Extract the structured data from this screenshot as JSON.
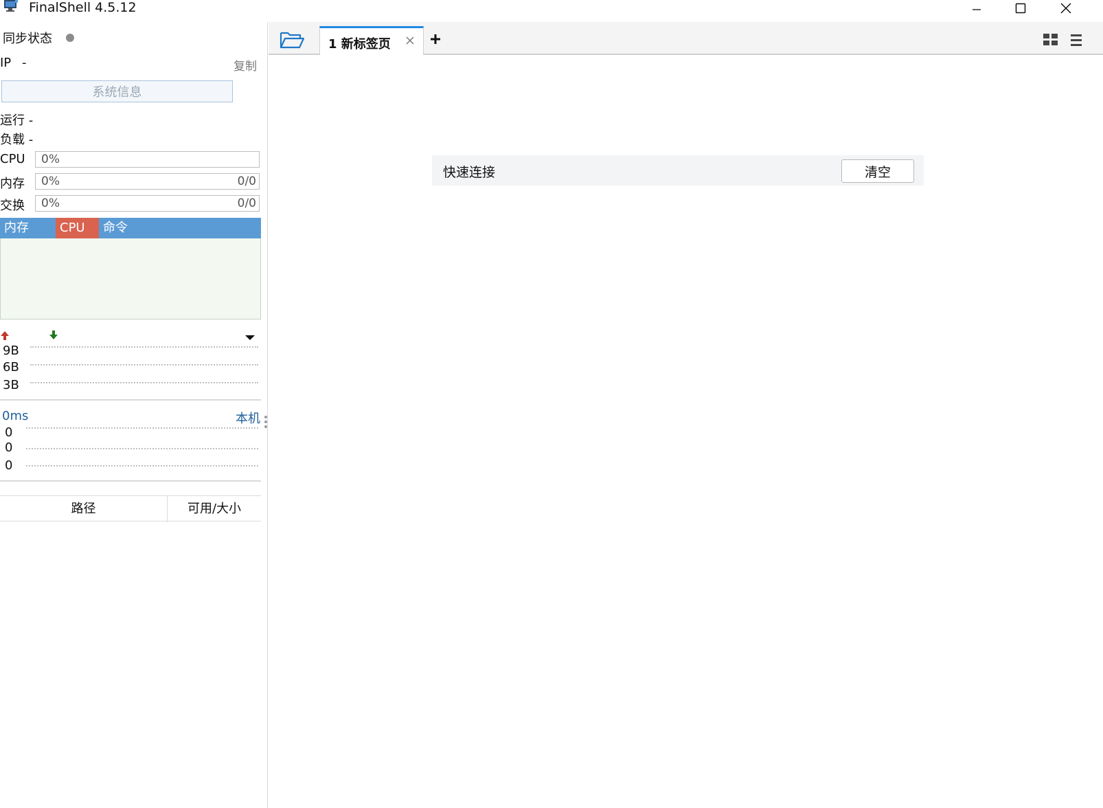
{
  "window": {
    "title": "FinalShell 4.5.12"
  },
  "sidebar": {
    "sync_label": "同步状态",
    "ip_label": "IP",
    "ip_value": "-",
    "copy_label": "复制",
    "sysinfo_button": "系统信息",
    "uptime_label": "运行 -",
    "load_label": "负载 -",
    "cpu": {
      "label": "CPU",
      "percent": "0%"
    },
    "memory": {
      "label": "内存",
      "percent": "0%",
      "value": "0/0"
    },
    "swap": {
      "label": "交换",
      "percent": "0%",
      "value": "0/0"
    },
    "process_tabs": {
      "mem": "内存",
      "cpu": "CPU",
      "cmd": "命令"
    },
    "network": {
      "ticks": [
        "9B",
        "6B",
        "3B"
      ]
    },
    "ping": {
      "latency": "0ms",
      "host": "本机",
      "ticks": [
        "0",
        "0",
        "0"
      ]
    },
    "disk_table": {
      "col_path": "路径",
      "col_size": "可用/大小"
    }
  },
  "tabs": [
    {
      "label": "1 新标签页",
      "active": true
    }
  ],
  "quick_connect": {
    "label": "快速连接",
    "clear_button": "清空"
  },
  "colors": {
    "accent": "#1e88e5",
    "proc_mem": "#5b9bd5",
    "proc_cpu": "#d9634f",
    "upload_arrow": "#c0392b",
    "download_arrow": "#1f7a1f"
  }
}
